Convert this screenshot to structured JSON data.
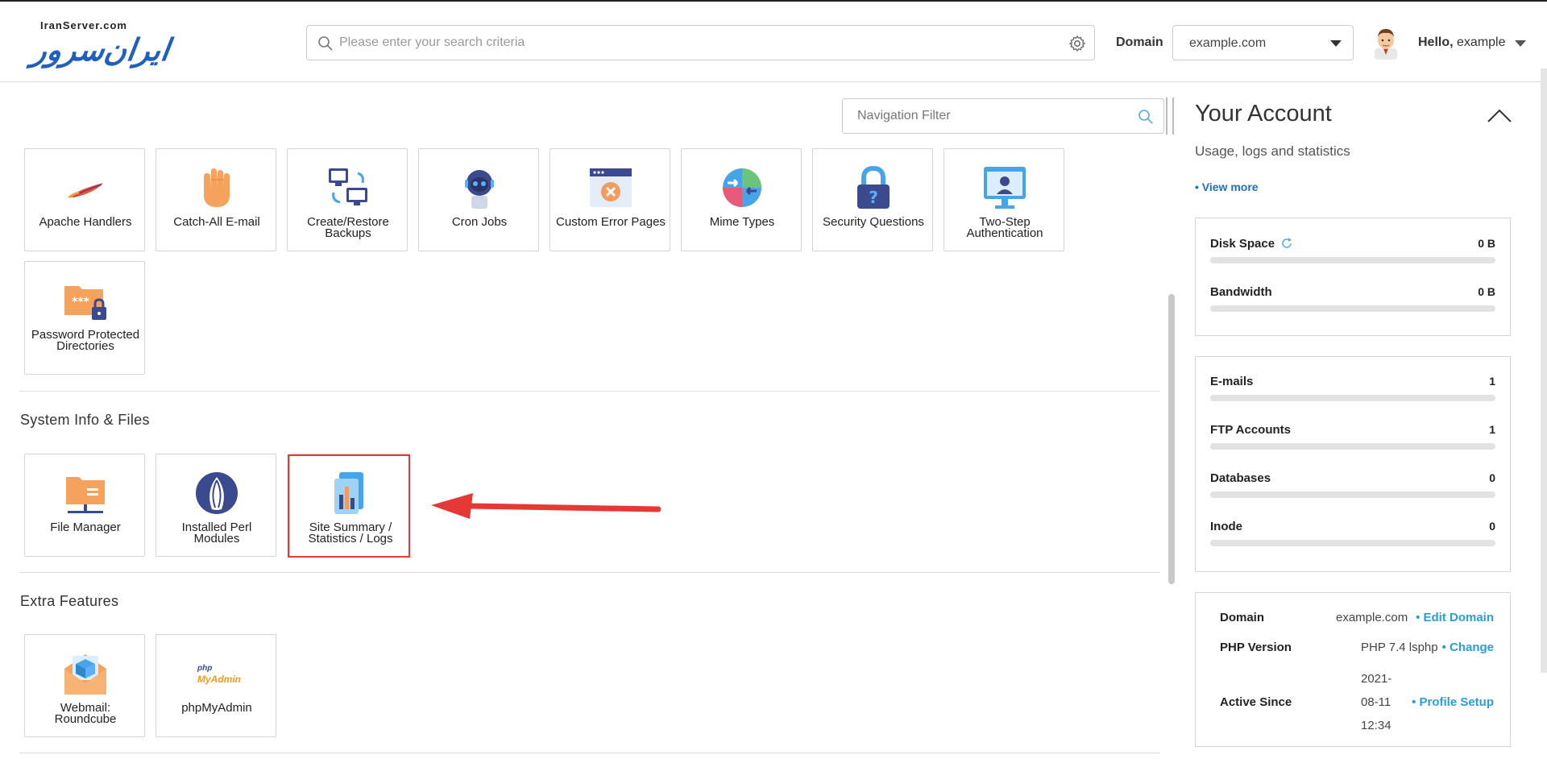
{
  "header": {
    "logo_small": "IranServer.com",
    "logo_main": "ایران‌سرور",
    "search_placeholder": "Please enter your search criteria",
    "domain_label": "Domain",
    "domain_value": "example.com",
    "hello_prefix": "Hello,",
    "hello_user": "example"
  },
  "main": {
    "nav_filter_placeholder": "Navigation Filter",
    "security_tiles": [
      {
        "label": "Apache Handlers",
        "icon": "feather-icon"
      },
      {
        "label": "Catch-All E-mail",
        "icon": "hand-icon"
      },
      {
        "label": "Create/Restore Backups",
        "icon": "backup-computers-icon"
      },
      {
        "label": "Cron Jobs",
        "icon": "robot-icon"
      },
      {
        "label": "Custom Error Pages",
        "icon": "error-page-icon"
      },
      {
        "label": "Mime Types",
        "icon": "mime-types-icon"
      },
      {
        "label": "Security Questions",
        "icon": "padlock-question-icon"
      },
      {
        "label": "Two-Step Authentication",
        "icon": "monitor-user-icon"
      },
      {
        "label": "Password Protected Directories",
        "icon": "locked-folder-icon"
      }
    ],
    "sections": [
      {
        "title": "System Info & Files",
        "tiles": [
          {
            "label": "File Manager",
            "icon": "folder-icon"
          },
          {
            "label": "Installed Perl Modules",
            "icon": "perl-onion-icon"
          },
          {
            "label": "Site Summary / Statistics / Logs",
            "icon": "statistics-icon"
          }
        ]
      },
      {
        "title": "Extra Features",
        "tiles": [
          {
            "label": "Webmail: Roundcube",
            "icon": "roundcube-envelope-icon"
          },
          {
            "label": "phpMyAdmin",
            "icon": "phpmyadmin-logo-icon",
            "logo_text_1": "php",
            "logo_text_2": "MyAdmin"
          }
        ]
      }
    ]
  },
  "account": {
    "title": "Your Account",
    "subtitle": "Usage, logs and statistics",
    "view_more": "• View more",
    "usage": [
      {
        "name": "Disk Space",
        "value": "0 B",
        "fraction": 0
      },
      {
        "name": "Bandwidth",
        "value": "0 B",
        "fraction": 0
      }
    ],
    "counts": [
      {
        "name": "E-mails",
        "value": "1",
        "fraction": 0
      },
      {
        "name": "FTP Accounts",
        "value": "1",
        "fraction": 0
      },
      {
        "name": "Databases",
        "value": "0",
        "fraction": 0
      },
      {
        "name": "Inode",
        "value": "0",
        "fraction": 0
      }
    ],
    "info": {
      "domain_label": "Domain",
      "domain_value": "example.com",
      "domain_link": "• Edit Domain",
      "php_label": "PHP Version",
      "php_value": "PHP 7.4 lsphp",
      "php_link": "• Change",
      "active_label": "Active Since",
      "active_date": "2021-",
      "active_date2": "08-11",
      "active_time": "12:34",
      "active_link": "• Profile Setup"
    }
  },
  "colors": {
    "highlight": "#e53935",
    "link": "#2a9fd6",
    "brand": "#1f5fbf"
  }
}
